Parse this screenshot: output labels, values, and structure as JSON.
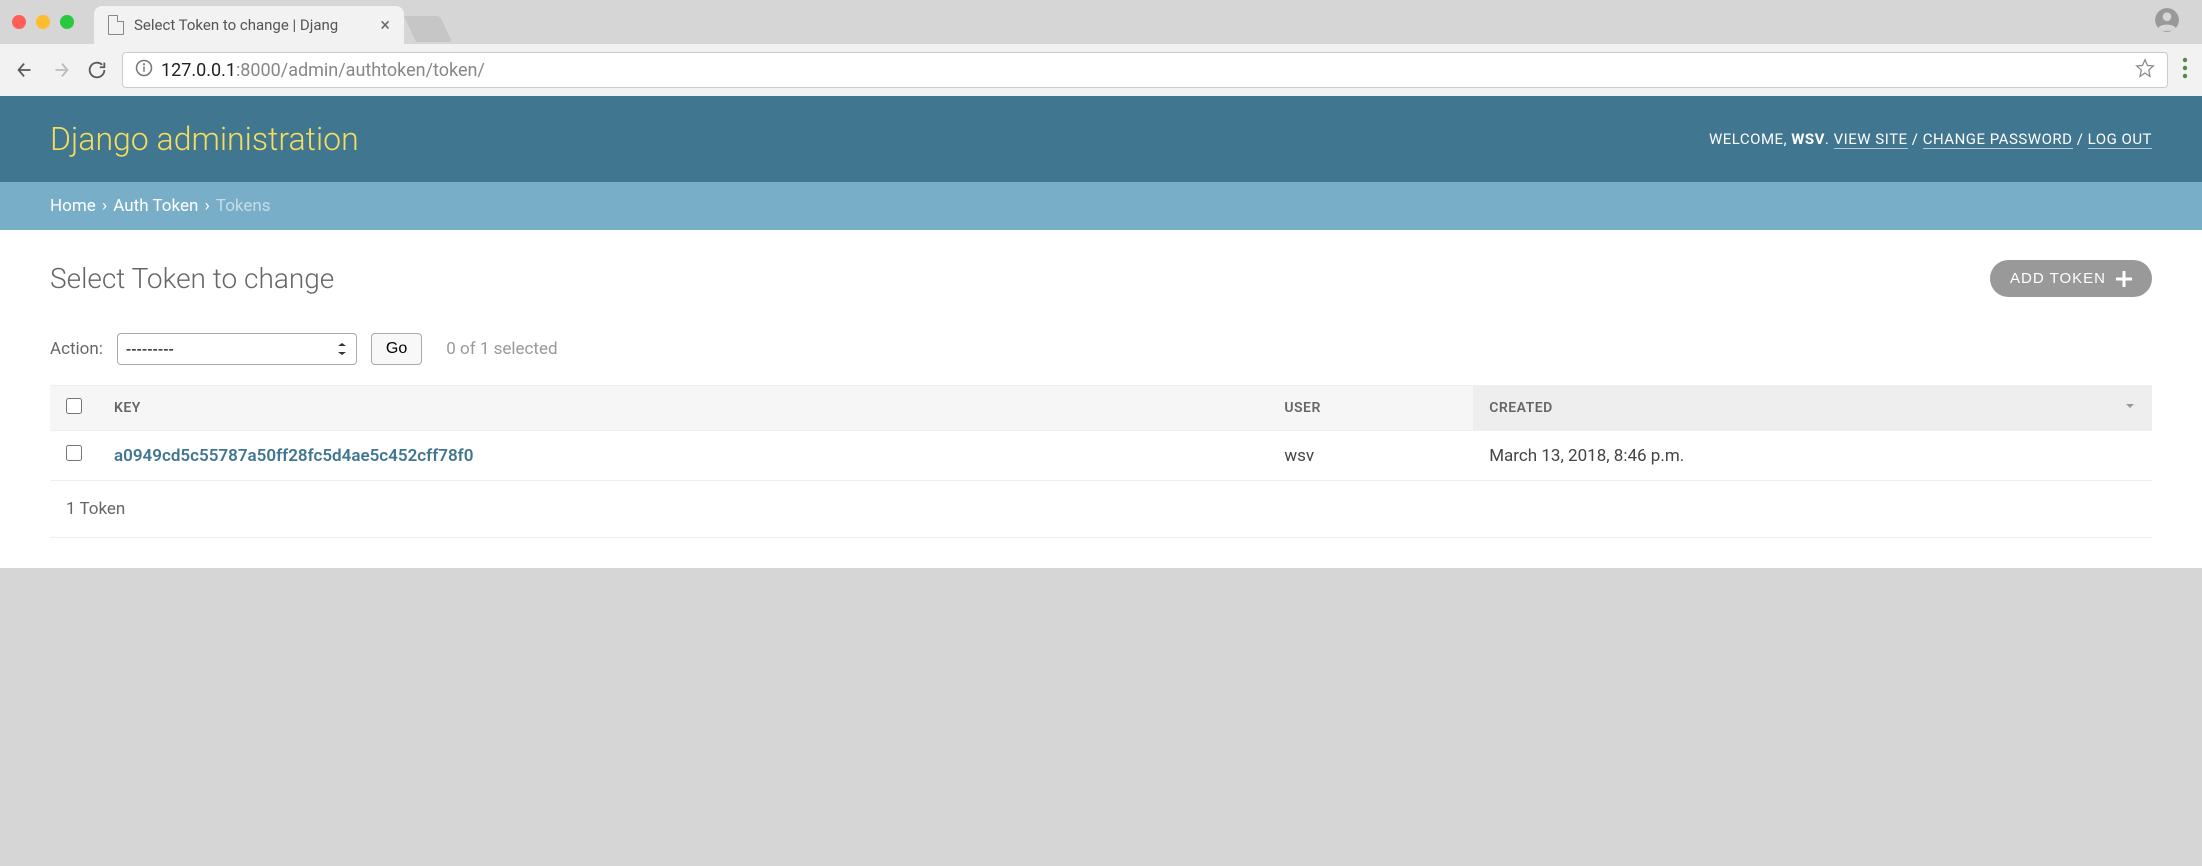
{
  "browser": {
    "tab_title": "Select Token to change | Djang",
    "url_host": "127.0.0.1",
    "url_port_path": ":8000/admin/authtoken/token/"
  },
  "header": {
    "site_title": "Django administration",
    "welcome_prefix": "WELCOME, ",
    "username": "WSV",
    "view_site": "VIEW SITE",
    "change_password": "CHANGE PASSWORD",
    "log_out": "LOG OUT",
    "sep_dot": ". ",
    "sep_slash": " / "
  },
  "breadcrumbs": {
    "home": "Home",
    "app": "Auth Token",
    "model": "Tokens",
    "sep": " › "
  },
  "content": {
    "page_title": "Select Token to change",
    "add_button": "ADD TOKEN",
    "actions_label": "Action:",
    "action_placeholder": "---------",
    "go_label": "Go",
    "selection_count": "0 of 1 selected",
    "columns": {
      "key": "KEY",
      "user": "USER",
      "created": "CREATED"
    },
    "rows": [
      {
        "key": "a0949cd5c55787a50ff28fc5d4ae5c452cff78f0",
        "user": "wsv",
        "created": "March 13, 2018, 8:46 p.m."
      }
    ],
    "paginator": "1 Token"
  }
}
